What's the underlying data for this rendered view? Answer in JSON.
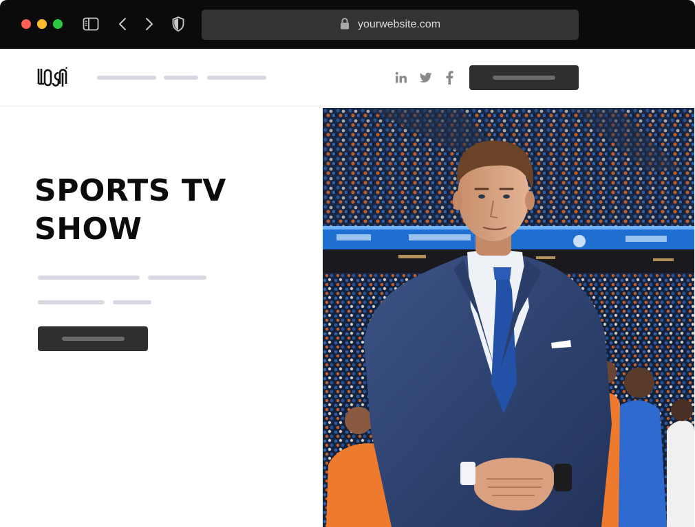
{
  "browser": {
    "url": "yourwebsite.com",
    "icons": [
      "close-light",
      "minimize-light",
      "maximize-light",
      "sidebar-icon",
      "back-arrow-icon",
      "forward-arrow-icon",
      "shield-icon",
      "lock-icon"
    ]
  },
  "nav": {
    "logo_text": "LOGO",
    "social_icons": [
      "linkedin-icon",
      "twitter-icon",
      "facebook-icon"
    ]
  },
  "hero": {
    "title_line1": "SPORTS TV",
    "title_line2": "SHOW"
  },
  "colors": {
    "chrome_bg": "#0b0b0b",
    "address_bar": "#333333",
    "button_dark": "#2f2f2f",
    "placeholder_line": "#d9d8e2",
    "suit_navy": "#2b3d66",
    "stadium_blue": "#1f5fb8",
    "crowd_orange": "#e86a26"
  }
}
